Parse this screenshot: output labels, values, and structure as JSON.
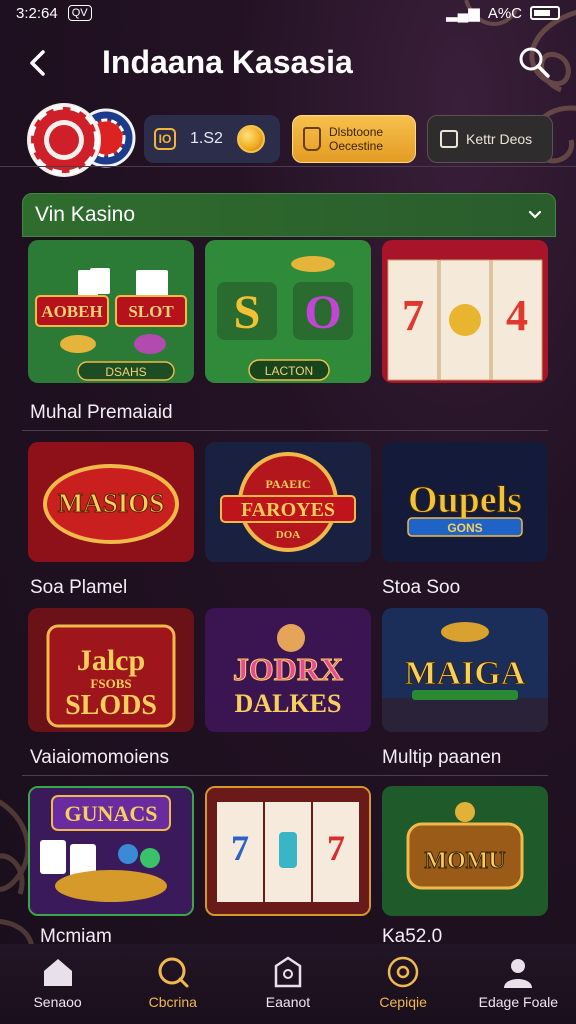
{
  "status_bar": {
    "time": "3:2:64",
    "pill": "QV",
    "network": "A%C"
  },
  "header": {
    "title": "Indaana Kasasia"
  },
  "balance": {
    "value": "1.S2",
    "icon_label": "IO"
  },
  "bonus_button": {
    "label": "Dlsbtoone Oecestine"
  },
  "deals_button": {
    "label": "Kettr Deos"
  },
  "section": {
    "title": "Vin Kasino"
  },
  "featured_tiles": [
    {
      "labels": [
        "AOBEH",
        "SLOT"
      ],
      "footer": "DSAHS"
    },
    {
      "labels": [
        "S",
        "O"
      ],
      "footer": "LACTON"
    },
    {
      "labels": [
        "7",
        "4"
      ],
      "footer": ""
    }
  ],
  "row_labels": {
    "row1": "Muhal Premaiaid",
    "row2_left": "Soa Plamel",
    "row2_right": "Stoa Soo",
    "row3_left": "Vaiaiomomoiens",
    "row3_right": "Multip paanen",
    "row4_left": "Mcmiam",
    "row4_right": "Ka52.0"
  },
  "game_tiles": [
    {
      "title": "MASIOS",
      "subtitle": ""
    },
    {
      "title": "FAROYES",
      "subtitle": "DOA",
      "top": "PAAEIC"
    },
    {
      "title": "Oupels",
      "subtitle": "GONS"
    },
    {
      "title": "Jalcp",
      "subtitle": "SLODS",
      "mid": "FSOBS"
    },
    {
      "title": "JODRX",
      "subtitle": "DALKES"
    },
    {
      "title": "MAIGA",
      "subtitle": ""
    },
    {
      "title": "GUNACS",
      "subtitle": ""
    },
    {
      "title": "7",
      "subtitle": ""
    },
    {
      "title": "MOMU",
      "subtitle": ""
    }
  ],
  "bottom_nav": [
    {
      "label": "Senaoo",
      "icon": "home-icon"
    },
    {
      "label": "Cbcrina",
      "icon": "search-circle-icon"
    },
    {
      "label": "Eaanot",
      "icon": "shield-icon"
    },
    {
      "label": "Cepiqie",
      "icon": "target-icon"
    },
    {
      "label": "Edage Foale",
      "icon": "user-icon"
    }
  ],
  "colors": {
    "accent_gold": "#f0b94a",
    "section_green": "#2f6d2e",
    "background": "#1f1020"
  }
}
